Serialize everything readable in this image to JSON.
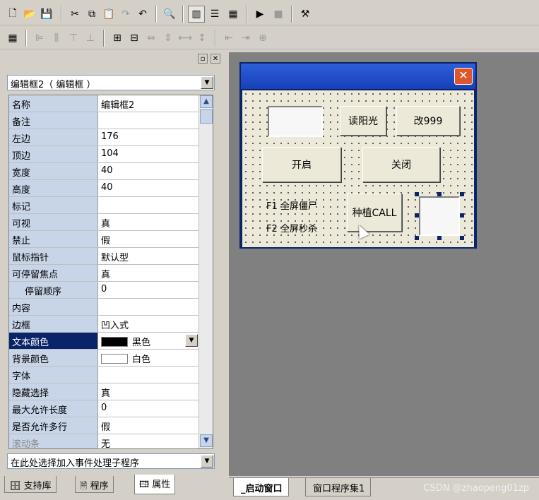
{
  "toolbar1": {
    "buttons": [
      "new-icon",
      "open-icon",
      "save-icon",
      "cut-icon",
      "copy-icon",
      "paste-icon",
      "redo-icon",
      "undo-icon",
      "find-icon",
      "layout-left-icon",
      "layout-bottom-icon",
      "layout-split-icon",
      "run-icon",
      "stop-icon",
      "compile-icon"
    ]
  },
  "panel": {
    "object_selector": "编辑框2（ 编辑框 ）",
    "properties": [
      {
        "name": "名称",
        "value": "编辑框2"
      },
      {
        "name": "备注",
        "value": ""
      },
      {
        "name": "左边",
        "value": "176"
      },
      {
        "name": "顶边",
        "value": "104"
      },
      {
        "name": "宽度",
        "value": "40"
      },
      {
        "name": "高度",
        "value": "40"
      },
      {
        "name": "标记",
        "value": ""
      },
      {
        "name": "可视",
        "value": "真"
      },
      {
        "name": "禁止",
        "value": "假"
      },
      {
        "name": "鼠标指针",
        "value": "默认型"
      },
      {
        "name": "可停留焦点",
        "value": "真"
      },
      {
        "name": "停留顺序",
        "value": "0"
      },
      {
        "name": "内容",
        "value": ""
      },
      {
        "name": "边框",
        "value": "凹入式"
      },
      {
        "name": "文本颜色",
        "value": "黑色"
      },
      {
        "name": "背景颜色",
        "value": "白色"
      },
      {
        "name": "字体",
        "value": ""
      },
      {
        "name": "隐藏选择",
        "value": "真"
      },
      {
        "name": "最大允许长度",
        "value": "0"
      },
      {
        "name": "是否允许多行",
        "value": "假"
      },
      {
        "name": "滚动条",
        "value": "无"
      }
    ],
    "event_selector": "在此处选择加入事件处理子程序",
    "tabs": [
      "支持库",
      "程序",
      "属性"
    ]
  },
  "form": {
    "buttons": {
      "read_sun": "读阳光",
      "change_999": "改999",
      "open": "开启",
      "close": "关闭",
      "plant_call": "种植CALL"
    },
    "labels": {
      "f1": "F1  全屏僵尸",
      "f2": "F2  全屏秒杀"
    }
  },
  "design_tabs": [
    "_启动窗口",
    "窗口程序集1"
  ],
  "watermark": "CSDN @zhaopeng01zp",
  "colors": {
    "accent": "#0a246a",
    "title": "#1640b8",
    "close": "#e0562c"
  }
}
